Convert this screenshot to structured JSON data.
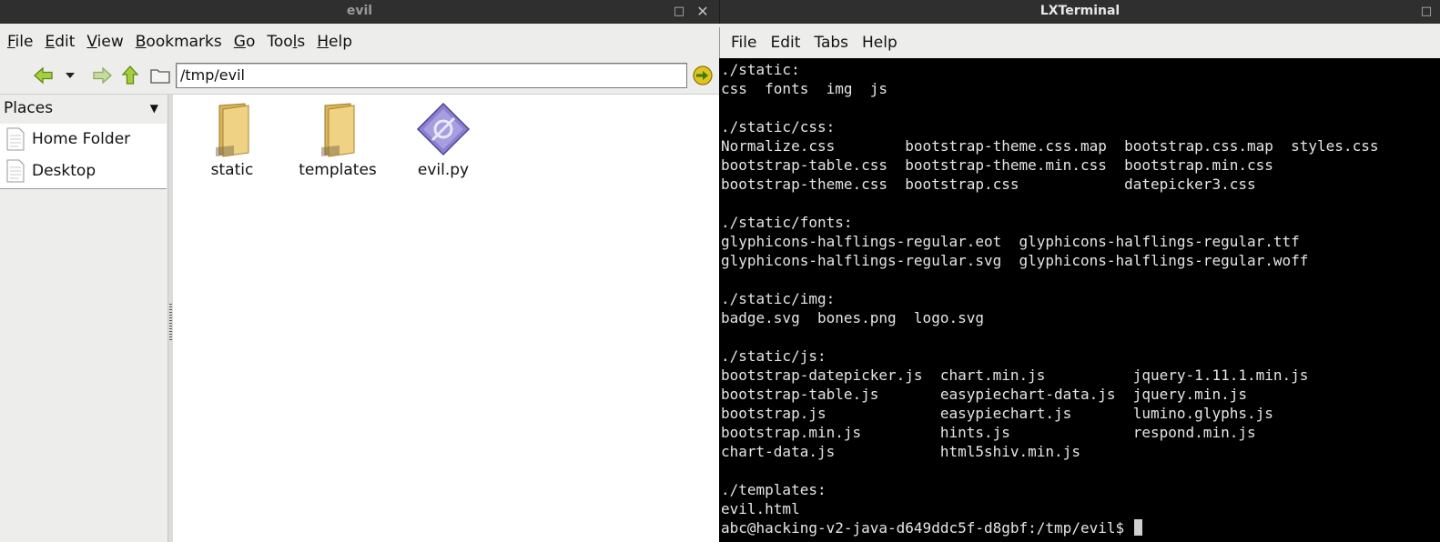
{
  "file_manager": {
    "window_title": "evil",
    "menu": [
      {
        "pre": "",
        "acc": "F",
        "post": "ile"
      },
      {
        "pre": "",
        "acc": "E",
        "post": "dit"
      },
      {
        "pre": "",
        "acc": "V",
        "post": "iew"
      },
      {
        "pre": "",
        "acc": "B",
        "post": "ookmarks"
      },
      {
        "pre": "",
        "acc": "G",
        "post": "o"
      },
      {
        "pre": "Too",
        "acc": "l",
        "post": "s"
      },
      {
        "pre": "",
        "acc": "H",
        "post": "elp"
      }
    ],
    "address": "/tmp/evil",
    "places_title": "Places",
    "places": [
      "Home Folder",
      "Desktop"
    ],
    "files": [
      {
        "name": "static",
        "icon": "folder-icon"
      },
      {
        "name": "templates",
        "icon": "folder-icon"
      },
      {
        "name": "evil.py",
        "icon": "python-file-icon"
      }
    ],
    "colors": {
      "accent_green": "#8fbf2a",
      "folder": "#e7c56c"
    }
  },
  "terminal": {
    "window_title": "LXTerminal",
    "menu": [
      "File",
      "Edit",
      "Tabs",
      "Help"
    ],
    "lines": [
      "./static:",
      "css  fonts  img  js",
      "",
      "./static/css:",
      "Normalize.css        bootstrap-theme.css.map  bootstrap.css.map  styles.css",
      "bootstrap-table.css  bootstrap-theme.min.css  bootstrap.min.css",
      "bootstrap-theme.css  bootstrap.css            datepicker3.css",
      "",
      "./static/fonts:",
      "glyphicons-halflings-regular.eot  glyphicons-halflings-regular.ttf",
      "glyphicons-halflings-regular.svg  glyphicons-halflings-regular.woff",
      "",
      "./static/img:",
      "badge.svg  bones.png  logo.svg",
      "",
      "./static/js:",
      "bootstrap-datepicker.js  chart.min.js          jquery-1.11.1.min.js",
      "bootstrap-table.js       easypiechart-data.js  jquery.min.js",
      "bootstrap.js             easypiechart.js       lumino.glyphs.js",
      "bootstrap.min.js         hints.js              respond.min.js",
      "chart-data.js            html5shiv.min.js",
      "",
      "./templates:",
      "evil.html"
    ],
    "prompt": "abc@hacking-v2-java-d649ddc5f-d8gbf:/tmp/evil$ "
  }
}
